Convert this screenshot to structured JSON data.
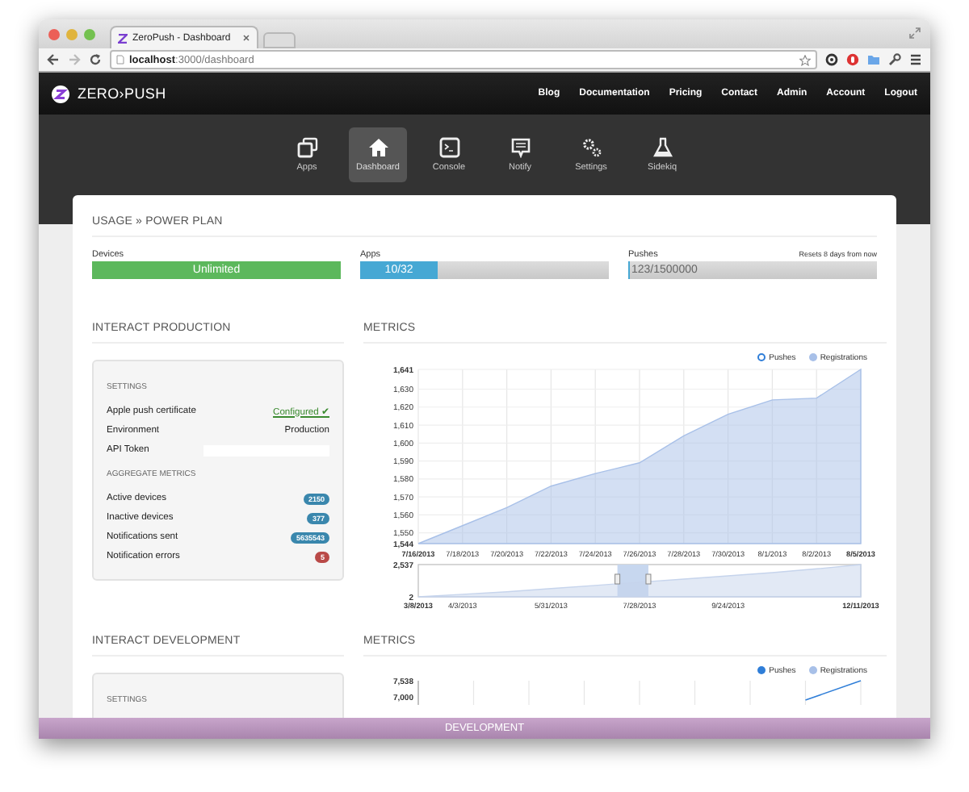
{
  "browser": {
    "tab_title": "ZeroPush - Dashboard",
    "url": "**localhost**:3000/dashboard"
  },
  "navbar": {
    "brand": "ZERO›PUSH",
    "links": [
      "Blog",
      "Documentation",
      "Pricing",
      "Contact",
      "Admin",
      "Account",
      "Logout"
    ]
  },
  "app_nav": [
    {
      "label": "Apps",
      "selected": false
    },
    {
      "label": "Dashboard",
      "selected": true
    },
    {
      "label": "Console",
      "selected": false
    },
    {
      "label": "Notify",
      "selected": false
    },
    {
      "label": "Settings",
      "selected": false
    },
    {
      "label": "Sidekiq",
      "selected": false
    }
  ],
  "usage": {
    "title": "USAGE » POWER PLAN",
    "meters": [
      {
        "label": "Devices",
        "reading": "Unlimited",
        "level": 1,
        "color": "#5cb85c"
      },
      {
        "label": "Apps",
        "reading": "10/32",
        "level": 0.3125,
        "color": "#46a8d4"
      },
      {
        "label": "Pushes",
        "reading": "123/1500000",
        "level": 0.0001,
        "color": "#46a8d4",
        "note": "Resets 8 days from now"
      }
    ]
  },
  "production": {
    "title": "INTERACT PRODUCTION",
    "settings_title": "SETTINGS",
    "settings": [
      {
        "label": "Apple push certificate",
        "kind": "link",
        "value": "Configured ✔"
      },
      {
        "label": "Environment",
        "kind": "text",
        "value": "Production"
      },
      {
        "label": "API Token",
        "kind": "field"
      }
    ],
    "metrics_title": "AGGREGATE METRICS",
    "metrics": [
      {
        "label": "Active devices",
        "value": "2150",
        "color": "#3a87ad"
      },
      {
        "label": "Inactive devices",
        "value": "377",
        "color": "#3a87ad"
      },
      {
        "label": "Notifications sent",
        "value": "5635543",
        "color": "#3a87ad"
      },
      {
        "label": "Notification errors",
        "value": "5",
        "color": "#b94a48"
      }
    ]
  },
  "production_metrics": {
    "title": "METRICS",
    "legend": [
      {
        "visible": false
      },
      {
        "visible": true
      }
    ],
    "chart_data": {
      "type": "area",
      "grid": true,
      "x": [
        "7/16/2013",
        "7/18/2013",
        "7/20/2013",
        "7/22/2013",
        "7/24/2013",
        "7/26/2013",
        "7/28/2013",
        "7/30/2013",
        "8/1/2013",
        "8/2/2013",
        "8/5/2013"
      ],
      "series": [
        {
          "name": "Pushes",
          "color": "#2f7ed8",
          "values": [
            null,
            null,
            null,
            null,
            null,
            null,
            null,
            null,
            null,
            null,
            null
          ]
        },
        {
          "name": "Registrations",
          "color": "#a8c0e8",
          "values": [
            1544,
            1554,
            1564,
            1576,
            1583,
            1589,
            1604,
            1616,
            1624,
            1625,
            1641
          ]
        }
      ],
      "ylim": [
        1544,
        1641
      ],
      "yticks": [
        {
          "value": 1544,
          "label": "1,544"
        },
        {
          "value": 1550,
          "label": "1,550"
        },
        {
          "value": 1560,
          "label": "1,560"
        },
        {
          "value": 1570,
          "label": "1,570"
        },
        {
          "value": 1580,
          "label": "1,580"
        },
        {
          "value": 1590,
          "label": "1,590"
        },
        {
          "value": 1600,
          "label": "1,600"
        },
        {
          "value": 1610,
          "label": "1,610"
        },
        {
          "value": 1620,
          "label": "1,620"
        },
        {
          "value": 1630,
          "label": "1,630"
        },
        {
          "value": 1641,
          "label": "1,641"
        }
      ]
    },
    "navigator": {
      "chart_data": {
        "type": "area",
        "x": [
          "3/8/2013",
          "4/3/2013",
          null,
          "5/31/2013",
          null,
          "7/28/2013",
          null,
          "9/24/2013",
          null,
          null,
          "12/11/2013"
        ],
        "series": [
          {
            "color": "#c6d4ec",
            "values": [
              2,
              200,
              400,
              650,
              900,
              1150,
              1400,
              1650,
              1900,
              2200,
              2537
            ]
          }
        ],
        "ylim": [
          2,
          2537
        ],
        "yticks": [
          {
            "value": 2,
            "label": "2"
          },
          {
            "value": 2537,
            "label": "2,537"
          }
        ]
      }
    }
  },
  "development": {
    "title": "INTERACT DEVELOPMENT",
    "settings_title": "SETTINGS"
  },
  "development_metrics": {
    "title": "METRICS",
    "legend": [
      {
        "label": "Pushes",
        "color": "#2f7ed8",
        "visible": true
      },
      {
        "label": "Registrations",
        "color": "#a8c0e8",
        "visible": true
      }
    ],
    "y_labels": [
      "7,538",
      "7,000"
    ]
  },
  "environment_bar": "DEVELOPMENT"
}
